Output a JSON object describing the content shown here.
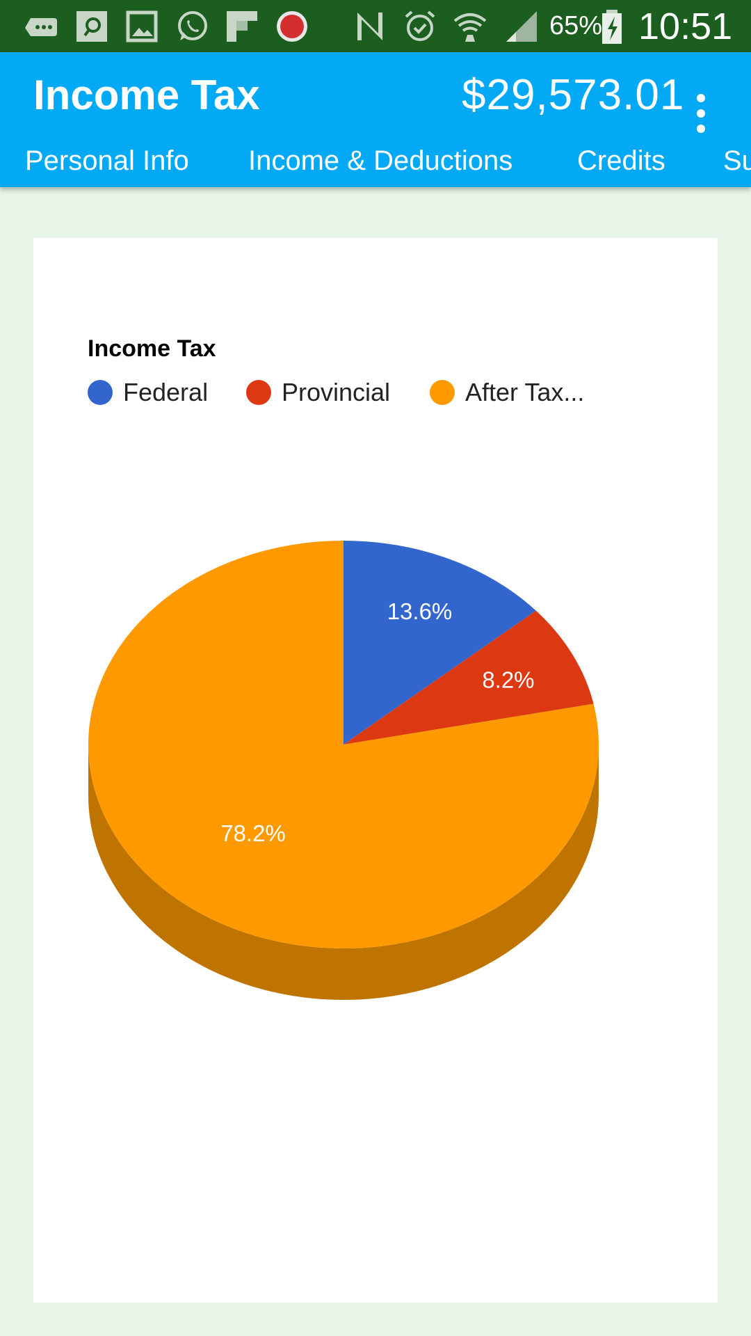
{
  "status_bar": {
    "battery_percent": "65%",
    "time": "10:51",
    "icons": [
      "messaging-icon",
      "app-icon",
      "gallery-icon",
      "whatsapp-icon",
      "flipboard-icon",
      "record-icon",
      "nfc-icon",
      "alarm-icon",
      "wifi-icon",
      "signal-icon",
      "battery-charging-icon"
    ]
  },
  "app_bar": {
    "title": "Income Tax",
    "amount": "$29,573.01",
    "menu_icon": "more-vert-icon"
  },
  "tabs": [
    {
      "label": "Personal Info"
    },
    {
      "label": "Income & Deductions"
    },
    {
      "label": "Credits"
    },
    {
      "label": "Su"
    }
  ],
  "colors": {
    "status_bar": "#1b5e20",
    "app_bar": "#03a9f4",
    "background": "#e8f5e9",
    "federal": "#3366cc",
    "provincial": "#dc3912",
    "after_tax": "#ff9900",
    "after_tax_side": "#c07400"
  },
  "chart_data": {
    "type": "pie",
    "title": "",
    "legend_title": "Income Tax",
    "legend_position": "top",
    "three_d": true,
    "slices": [
      {
        "name": "Federal",
        "value": 13.6,
        "label": "13.6%",
        "color": "#3366cc"
      },
      {
        "name": "Provincial",
        "value": 8.2,
        "label": "8.2%",
        "color": "#dc3912"
      },
      {
        "name": "After Tax...",
        "value": 78.2,
        "label": "78.2%",
        "color": "#ff9900"
      }
    ]
  }
}
